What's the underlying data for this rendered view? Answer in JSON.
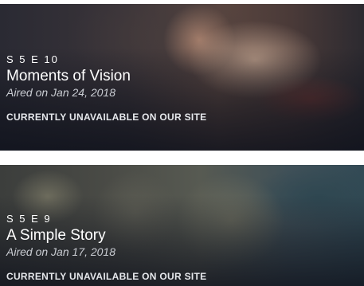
{
  "episodes": [
    {
      "number": "S 5 E 10",
      "title": "Moments of Vision",
      "aired": "Aired on Jan 24, 2018",
      "status": "CURRENTLY UNAVAILABLE ON OUR SITE"
    },
    {
      "number": "S 5 E 9",
      "title": "A Simple Story",
      "aired": "Aired on Jan 17, 2018",
      "status": "CURRENTLY UNAVAILABLE ON OUR SITE"
    }
  ]
}
